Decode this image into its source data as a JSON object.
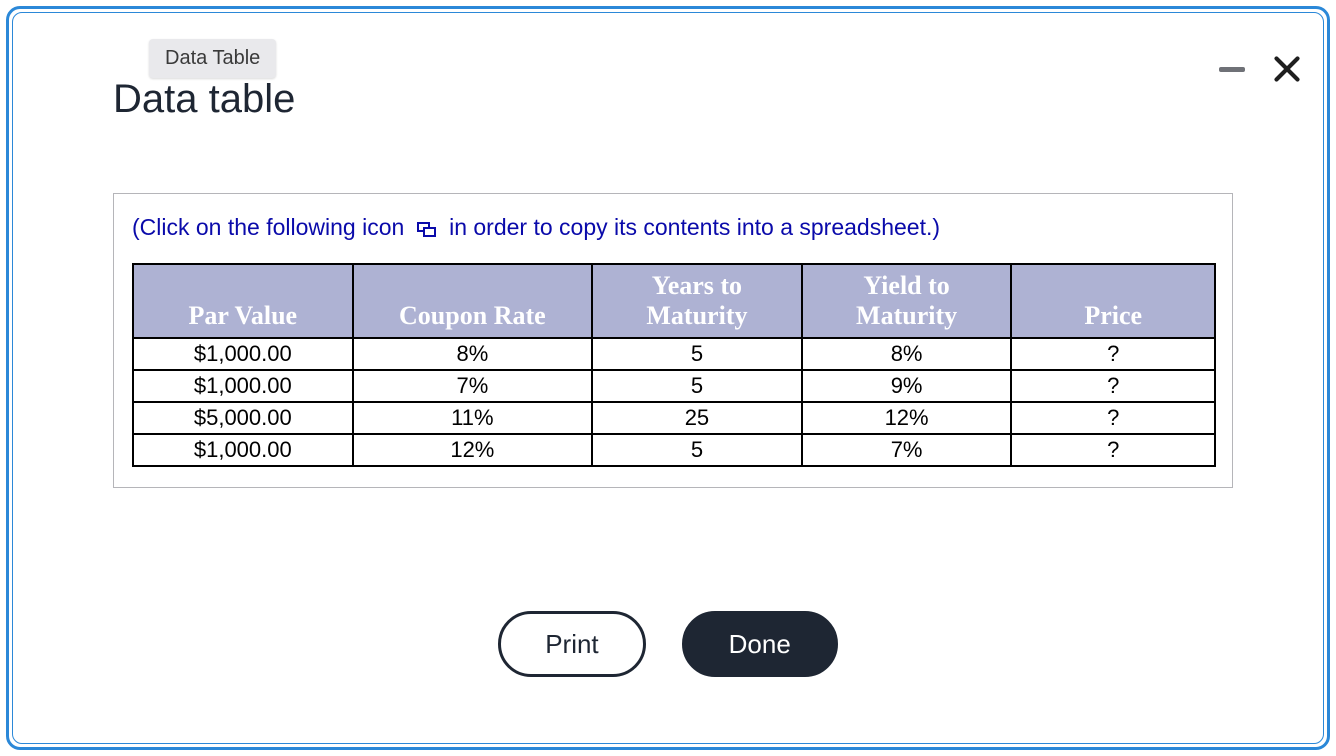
{
  "tooltip": "Data Table",
  "title": "Data table",
  "hint": {
    "pre": "(Click on the following icon",
    "post": "in order to copy its contents into a spreadsheet.)"
  },
  "table": {
    "headers": [
      "Par Value",
      "Coupon Rate",
      "Years to\nMaturity",
      "Yield to\nMaturity",
      "Price"
    ],
    "rows": [
      [
        "$1,000.00",
        "8%",
        "5",
        "8%",
        "?"
      ],
      [
        "$1,000.00",
        "7%",
        "5",
        "9%",
        "?"
      ],
      [
        "$5,000.00",
        "11%",
        "25",
        "12%",
        "?"
      ],
      [
        "$1,000.00",
        "12%",
        "5",
        "7%",
        "?"
      ]
    ]
  },
  "buttons": {
    "print": "Print",
    "done": "Done"
  }
}
